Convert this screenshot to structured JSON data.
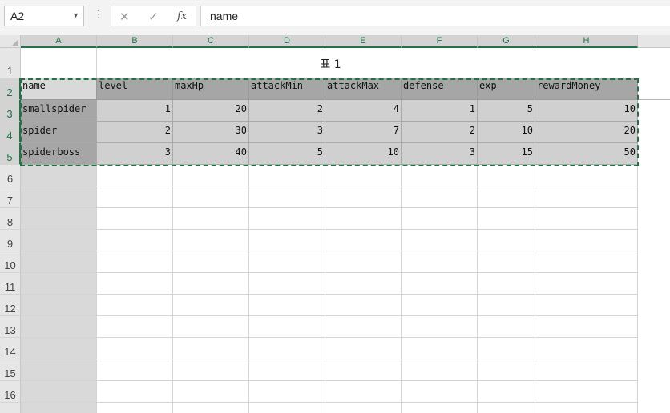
{
  "formula_bar": {
    "name_box": "A2",
    "cancel_icon": "✕",
    "enter_icon": "✓",
    "function_icon": "fx",
    "formula": "name"
  },
  "columns": [
    "A",
    "B",
    "C",
    "D",
    "E",
    "F",
    "G",
    "H"
  ],
  "rows": [
    "1",
    "2",
    "3",
    "4",
    "5",
    "6",
    "7",
    "8",
    "9",
    "10",
    "11",
    "12",
    "13",
    "14",
    "15",
    "16"
  ],
  "table_title": "표 1",
  "table": {
    "headers": [
      "name",
      "level",
      "maxHp",
      "attackMin",
      "attackMax",
      "defense",
      "exp",
      "rewardMoney"
    ],
    "rows": [
      [
        "smallspider",
        "1",
        "20",
        "2",
        "4",
        "1",
        "5",
        "10"
      ],
      [
        "spider",
        "2",
        "30",
        "3",
        "7",
        "2",
        "10",
        "20"
      ],
      [
        "spiderboss",
        "3",
        "40",
        "5",
        "10",
        "3",
        "15",
        "50"
      ]
    ]
  },
  "colors": {
    "accent": "#217346",
    "header_fill": "#a6a6a6",
    "data_fill": "#d0d0d0"
  }
}
